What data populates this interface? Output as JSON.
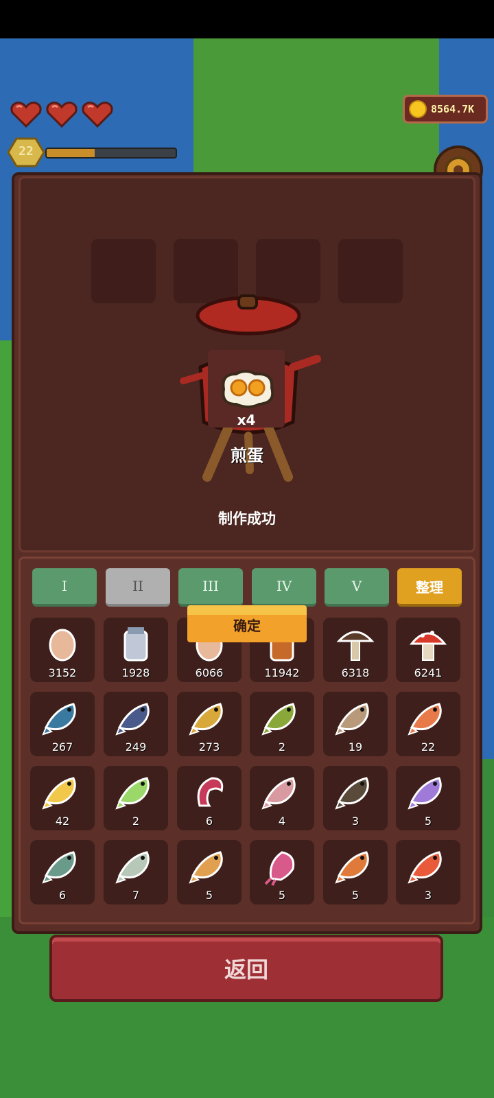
{
  "hud": {
    "level": "22",
    "xp_fraction": 0.37,
    "hearts": 3,
    "coins": "8564.7K"
  },
  "crafting": {
    "result_count": "x4",
    "result_name": "煎蛋",
    "status": "制作成功"
  },
  "tabs": [
    {
      "label": "I"
    },
    {
      "label": "II"
    },
    {
      "label": "III"
    },
    {
      "label": "IV"
    },
    {
      "label": "V"
    }
  ],
  "sort_label": "整理",
  "confirm_label": "确定",
  "items": [
    {
      "icon": "egg-icon",
      "qty": "3152"
    },
    {
      "icon": "milk-jar-icon",
      "qty": "1928"
    },
    {
      "icon": "egg-icon",
      "qty": "6066"
    },
    {
      "icon": "honey-jar-icon",
      "qty": "11942"
    },
    {
      "icon": "brown-mushroom-icon",
      "qty": "6318"
    },
    {
      "icon": "red-mushroom-icon",
      "qty": "6241"
    },
    {
      "icon": "fish-icon",
      "qty": "267"
    },
    {
      "icon": "fish-icon",
      "qty": "249"
    },
    {
      "icon": "fish-icon",
      "qty": "273"
    },
    {
      "icon": "fish-icon",
      "qty": "2"
    },
    {
      "icon": "fish-icon",
      "qty": "19"
    },
    {
      "icon": "fish-icon",
      "qty": "22"
    },
    {
      "icon": "fish-icon",
      "qty": "42"
    },
    {
      "icon": "fish-icon",
      "qty": "2"
    },
    {
      "icon": "shrimp-icon",
      "qty": "6"
    },
    {
      "icon": "fish-icon",
      "qty": "4"
    },
    {
      "icon": "fish-icon",
      "qty": "3"
    },
    {
      "icon": "fish-icon",
      "qty": "5"
    },
    {
      "icon": "fish-icon",
      "qty": "6"
    },
    {
      "icon": "fish-icon",
      "qty": "7"
    },
    {
      "icon": "fish-icon",
      "qty": "5"
    },
    {
      "icon": "squid-icon",
      "qty": "5"
    },
    {
      "icon": "fish-icon",
      "qty": "5"
    },
    {
      "icon": "fish-icon",
      "qty": "3"
    }
  ],
  "item_colors": [
    "#e8b89a",
    "#c0c8d8",
    "#e8b89a",
    "#c66a2a",
    "#5a3a28",
    "#d83a2a",
    "#3a7aa0",
    "#4a5a8a",
    "#d8a83a",
    "#8aa83a",
    "#b89a7a",
    "#e87a4a",
    "#f2c84a",
    "#9ad86a",
    "#c83a5a",
    "#d89aa0",
    "#5a4a3a",
    "#a07ad8",
    "#6a9a8a",
    "#b8c8b8",
    "#e0a050",
    "#d85a8a",
    "#e07a3a",
    "#e85a3a"
  ],
  "back_label": "返回"
}
